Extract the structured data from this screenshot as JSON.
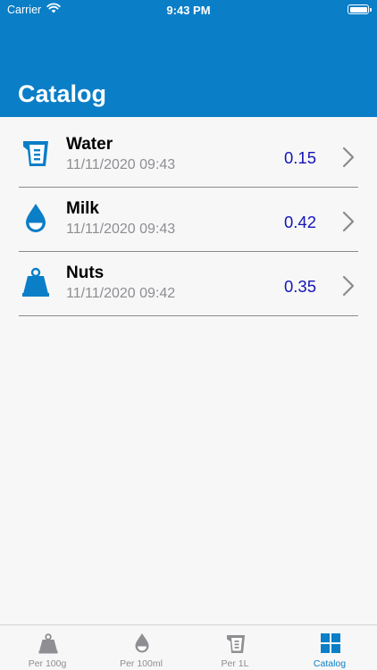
{
  "status_bar": {
    "carrier": "Carrier",
    "time": "9:43 PM"
  },
  "header": {
    "title": "Catalog"
  },
  "items": [
    {
      "name": "Water",
      "date": "11/11/2020 09:43",
      "value": "0.15",
      "icon": "measuring-jug-icon"
    },
    {
      "name": "Milk",
      "date": "11/11/2020 09:43",
      "value": "0.42",
      "icon": "droplet-icon"
    },
    {
      "name": "Nuts",
      "date": "11/11/2020 09:42",
      "value": "0.35",
      "icon": "weight-icon"
    }
  ],
  "tabs": [
    {
      "label": "Per 100g",
      "icon": "weight-icon",
      "active": false
    },
    {
      "label": "Per 100ml",
      "icon": "droplet-icon",
      "active": false
    },
    {
      "label": "Per 1L",
      "icon": "measuring-jug-icon",
      "active": false
    },
    {
      "label": "Catalog",
      "icon": "grid-icon",
      "active": true
    }
  ],
  "colors": {
    "accent": "#0a7ec7",
    "value": "#1515b8",
    "inactive": "#8e8e93"
  }
}
